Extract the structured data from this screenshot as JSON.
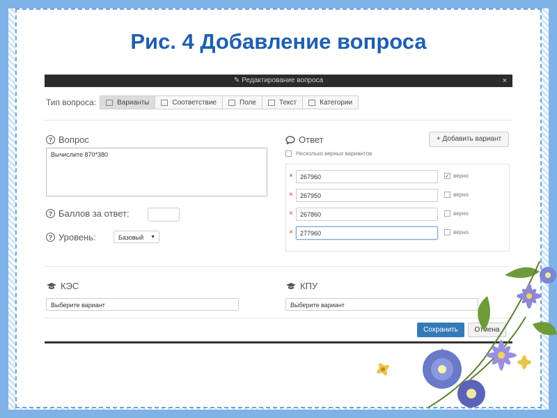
{
  "slide": {
    "title": "Рис. 4  Добавление вопроса"
  },
  "dialog": {
    "title": "Редактирование вопроса",
    "close": "×"
  },
  "question_type": {
    "label": "Тип вопроса:",
    "options": [
      "Варианты",
      "Соответствие",
      "Поле",
      "Текст",
      "Категории"
    ],
    "selected": "Варианты"
  },
  "question": {
    "heading": "Вопрос",
    "text": "Вычислите  870*380"
  },
  "points": {
    "label": "Баллов за ответ:",
    "value": ""
  },
  "level": {
    "label": "Уровень:",
    "value": "Базовый"
  },
  "answer": {
    "heading": "Ответ",
    "add_button": "+ Добавить вариант",
    "multiple_label": "Несколько верных вариантов",
    "correct_label": "верно",
    "options": [
      {
        "value": "267960",
        "correct": true
      },
      {
        "value": "267950",
        "correct": false
      },
      {
        "value": "267860",
        "correct": false
      },
      {
        "value": "277960",
        "correct": false
      }
    ]
  },
  "kes": {
    "label": "КЭС",
    "placeholder": "Выберите вариант"
  },
  "kpu": {
    "label": "КПУ",
    "placeholder": "Выберите вариант"
  },
  "buttons": {
    "save": "Сохранить",
    "cancel": "Отмена"
  },
  "colors": {
    "title": "#1f5fb0",
    "primary": "#337ab7",
    "border_decor": "#7fb3e8"
  }
}
